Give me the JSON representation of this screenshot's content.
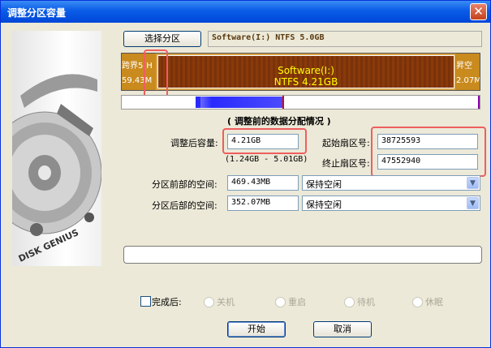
{
  "window": {
    "title": "调整分区容量",
    "close_glyph": "✕"
  },
  "select_partition": {
    "label": "选择分区",
    "info": "Software(I:) NTFS 5.0GB"
  },
  "partition_bar": {
    "left_name": "跨界5(H",
    "left_size": "59.43M",
    "center_name": "Software(I:)",
    "center_fs": "NTFS 4.21GB",
    "right_name": "昇空",
    "right_size": "2.07M"
  },
  "section_heading": "( 调整前的数据分配情况 )",
  "new_size": {
    "label": "调整后容量:",
    "value": "4.21GB",
    "range": "(1.24GB - 5.01GB)"
  },
  "start_sector": {
    "label": "起始扇区号:",
    "value": "38725593"
  },
  "end_sector": {
    "label": "终止扇区号:",
    "value": "47552940"
  },
  "space_before": {
    "label": "分区前部的空间:",
    "value": "469.43MB",
    "option": "保持空闲"
  },
  "space_after": {
    "label": "分区后部的空间:",
    "value": "352.07MB",
    "option": "保持空闲"
  },
  "after_complete": {
    "label": "完成后:",
    "options": [
      "关机",
      "重启",
      "待机",
      "休眠"
    ]
  },
  "buttons": {
    "start": "开始",
    "cancel": "取消"
  },
  "logo_text": "DISK GENIUS",
  "colors": {
    "title_blue": "#0a5ce6",
    "partition_brown": "#8a3a0a",
    "partition_text": "#ffff00",
    "highlight_red": "#ee5f5f"
  }
}
